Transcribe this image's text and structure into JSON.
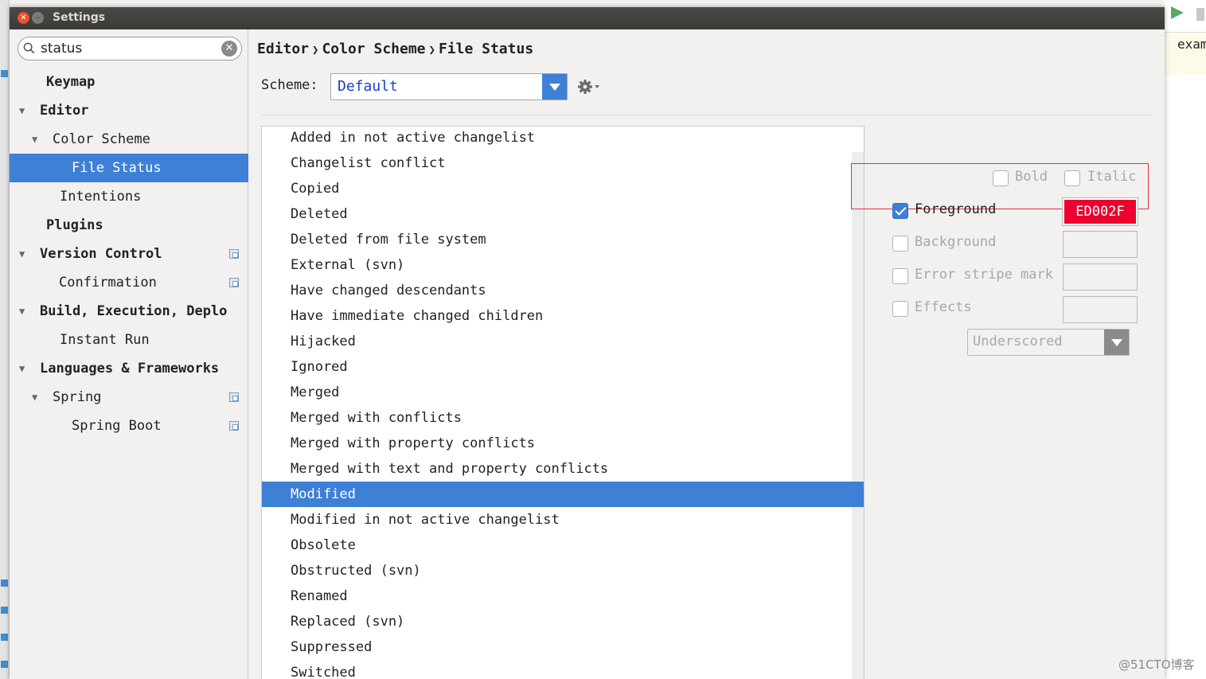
{
  "window": {
    "title": "Settings"
  },
  "background": {
    "right_tab": "exam"
  },
  "watermark": "@51CTO博客",
  "sidebar": {
    "search": {
      "value": "status",
      "placeholder": ""
    },
    "items": [
      {
        "label": "Keymap",
        "expanded": null,
        "selected": false,
        "bold": true,
        "project_icon": false
      },
      {
        "label": "Editor",
        "expanded": true,
        "selected": false,
        "bold": true,
        "project_icon": false
      },
      {
        "label": "Color Scheme",
        "expanded": true,
        "selected": false,
        "bold": false,
        "project_icon": false
      },
      {
        "label": "File Status",
        "expanded": null,
        "selected": true,
        "bold": false,
        "project_icon": false
      },
      {
        "label": "Intentions",
        "expanded": null,
        "selected": false,
        "bold": false,
        "project_icon": false
      },
      {
        "label": "Plugins",
        "expanded": null,
        "selected": false,
        "bold": true,
        "project_icon": false
      },
      {
        "label": "Version Control",
        "expanded": true,
        "selected": false,
        "bold": true,
        "project_icon": true
      },
      {
        "label": "Confirmation",
        "expanded": null,
        "selected": false,
        "bold": false,
        "project_icon": true
      },
      {
        "label": "Build, Execution, Deplo",
        "expanded": true,
        "selected": false,
        "bold": true,
        "project_icon": false
      },
      {
        "label": "Instant Run",
        "expanded": null,
        "selected": false,
        "bold": false,
        "project_icon": false
      },
      {
        "label": "Languages & Frameworks",
        "expanded": true,
        "selected": false,
        "bold": true,
        "project_icon": false
      },
      {
        "label": "Spring",
        "expanded": true,
        "selected": false,
        "bold": false,
        "project_icon": true
      },
      {
        "label": "Spring Boot",
        "expanded": null,
        "selected": false,
        "bold": false,
        "project_icon": true
      }
    ]
  },
  "main": {
    "breadcrumb": [
      "Editor",
      "Color Scheme",
      "File Status"
    ],
    "scheme": {
      "label": "Scheme:",
      "value": "Default"
    },
    "statuses": [
      "Added in not active changelist",
      "Changelist conflict",
      "Copied",
      "Deleted",
      "Deleted from file system",
      "External (svn)",
      "Have changed descendants",
      "Have immediate changed children",
      "Hijacked",
      "Ignored",
      "Merged",
      "Merged with conflicts",
      "Merged with property conflicts",
      "Merged with text and property conflicts",
      "Modified",
      "Modified in not active changelist",
      "Obsolete",
      "Obstructed (svn)",
      "Renamed",
      "Replaced (svn)",
      "Suppressed",
      "Switched"
    ],
    "selected_status": "Modified"
  },
  "attributes": {
    "bold": {
      "label": "Bold",
      "checked": false
    },
    "italic": {
      "label": "Italic",
      "checked": false
    },
    "foreground": {
      "label": "Foreground",
      "checked": true,
      "color": "ED002F",
      "hex": "#ED002F"
    },
    "background": {
      "label": "Background",
      "checked": false
    },
    "error_stripe": {
      "label": "Error stripe mark",
      "checked": false
    },
    "effects": {
      "label": "Effects",
      "checked": false,
      "type": "Underscored"
    }
  },
  "colors": {
    "accent": "#3D80D6",
    "foreground_swatch": "#ED002F",
    "highlight_box": "#E0303A"
  }
}
